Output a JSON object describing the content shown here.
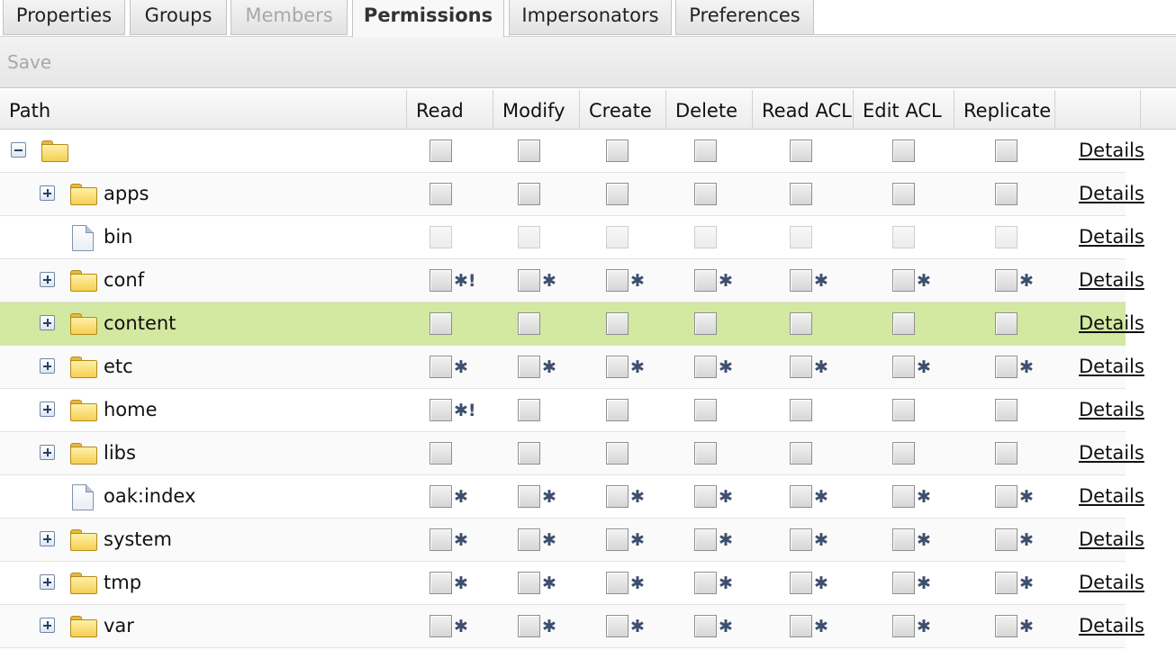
{
  "tabs": [
    {
      "label": "Properties",
      "state": "normal"
    },
    {
      "label": "Groups",
      "state": "normal"
    },
    {
      "label": "Members",
      "state": "disabled"
    },
    {
      "label": "Permissions",
      "state": "active"
    },
    {
      "label": "Impersonators",
      "state": "normal"
    },
    {
      "label": "Preferences",
      "state": "normal"
    }
  ],
  "toolbar": {
    "save_label": "Save"
  },
  "grid": {
    "columns": [
      "Path",
      "Read",
      "Modify",
      "Create",
      "Delete",
      "Read ACL",
      "Edit ACL",
      "Replicate",
      ""
    ],
    "details_label": "Details",
    "rows": [
      {
        "name": "",
        "icon": "folder-icon",
        "toggle": "collapse",
        "depth": 0,
        "disabled": false,
        "selected": false,
        "marks": [
          "",
          "",
          "",
          "",
          "",
          "",
          ""
        ]
      },
      {
        "name": "apps",
        "icon": "folder-icon",
        "toggle": "expand",
        "depth": 1,
        "disabled": false,
        "selected": false,
        "marks": [
          "",
          "",
          "",
          "",
          "",
          "",
          ""
        ]
      },
      {
        "name": "bin",
        "icon": "file-icon",
        "toggle": "",
        "depth": 1,
        "disabled": true,
        "selected": false,
        "marks": [
          "",
          "",
          "",
          "",
          "",
          "",
          ""
        ]
      },
      {
        "name": "conf",
        "icon": "folder-icon",
        "toggle": "expand",
        "depth": 1,
        "disabled": false,
        "selected": false,
        "marks": [
          "✱!",
          "✱",
          "✱",
          "✱",
          "✱",
          "✱",
          "✱"
        ]
      },
      {
        "name": "content",
        "icon": "folder-icon",
        "toggle": "expand",
        "depth": 1,
        "disabled": false,
        "selected": true,
        "marks": [
          "",
          "",
          "",
          "",
          "",
          "",
          ""
        ]
      },
      {
        "name": "etc",
        "icon": "folder-icon",
        "toggle": "expand",
        "depth": 1,
        "disabled": false,
        "selected": false,
        "marks": [
          "✱",
          "✱",
          "✱",
          "✱",
          "✱",
          "✱",
          "✱"
        ]
      },
      {
        "name": "home",
        "icon": "folder-icon",
        "toggle": "expand",
        "depth": 1,
        "disabled": false,
        "selected": false,
        "marks": [
          "✱!",
          "",
          "",
          "",
          "",
          "",
          ""
        ]
      },
      {
        "name": "libs",
        "icon": "folder-icon",
        "toggle": "expand",
        "depth": 1,
        "disabled": false,
        "selected": false,
        "marks": [
          "",
          "",
          "",
          "",
          "",
          "",
          ""
        ]
      },
      {
        "name": "oak:index",
        "icon": "file-icon",
        "toggle": "",
        "depth": 1,
        "disabled": false,
        "selected": false,
        "marks": [
          "✱",
          "✱",
          "✱",
          "✱",
          "✱",
          "✱",
          "✱"
        ]
      },
      {
        "name": "system",
        "icon": "folder-icon",
        "toggle": "expand",
        "depth": 1,
        "disabled": false,
        "selected": false,
        "marks": [
          "✱",
          "✱",
          "✱",
          "✱",
          "✱",
          "✱",
          "✱"
        ]
      },
      {
        "name": "tmp",
        "icon": "folder-icon",
        "toggle": "expand",
        "depth": 1,
        "disabled": false,
        "selected": false,
        "marks": [
          "✱",
          "✱",
          "✱",
          "✱",
          "✱",
          "✱",
          "✱"
        ]
      },
      {
        "name": "var",
        "icon": "folder-icon",
        "toggle": "expand",
        "depth": 1,
        "disabled": false,
        "selected": false,
        "marks": [
          "✱",
          "✱",
          "✱",
          "✱",
          "✱",
          "✱",
          "✱"
        ]
      }
    ]
  }
}
